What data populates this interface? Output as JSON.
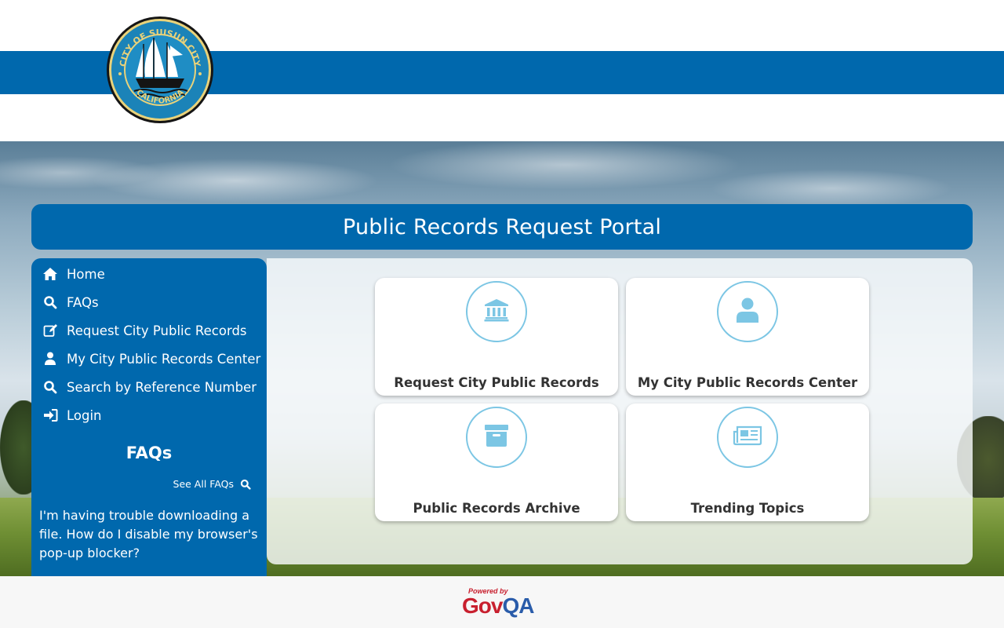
{
  "header": {
    "logo": {
      "top_text": "CITY OF SUISUN CITY",
      "bottom_text": "CALIFORNIA"
    },
    "brand_color": "#0068ad"
  },
  "title_bar": {
    "title": "Public Records Request Portal"
  },
  "sidebar": {
    "nav": [
      {
        "label": "Home",
        "icon": "home-icon"
      },
      {
        "label": "FAQs",
        "icon": "search-icon"
      },
      {
        "label": "Request City Public Records",
        "icon": "edit-icon"
      },
      {
        "label": "My City Public Records Center",
        "icon": "user-icon"
      },
      {
        "label": "Search by Reference Number",
        "icon": "search-icon"
      },
      {
        "label": "Login",
        "icon": "sign-in-icon"
      }
    ],
    "faq_heading": "FAQs",
    "see_all_label": "See All FAQs",
    "faq_items": [
      {
        "text": "I'm having trouble downloading a file. How do I disable my browser's pop-up blocker?"
      }
    ]
  },
  "tiles": [
    {
      "label": "Request City Public Records",
      "icon": "institution-icon"
    },
    {
      "label": "My City Public Records Center",
      "icon": "user-icon"
    },
    {
      "label": "Public Records Archive",
      "icon": "archive-icon"
    },
    {
      "label": "Trending Topics",
      "icon": "newspaper-icon"
    }
  ],
  "colors": {
    "accent": "#0068ad",
    "icon_accent": "#7cc6e4",
    "tile_text": "#333333"
  },
  "footer": {
    "powered_by": "Powered by",
    "brand_part1": "Gov",
    "brand_part2": "QA"
  }
}
